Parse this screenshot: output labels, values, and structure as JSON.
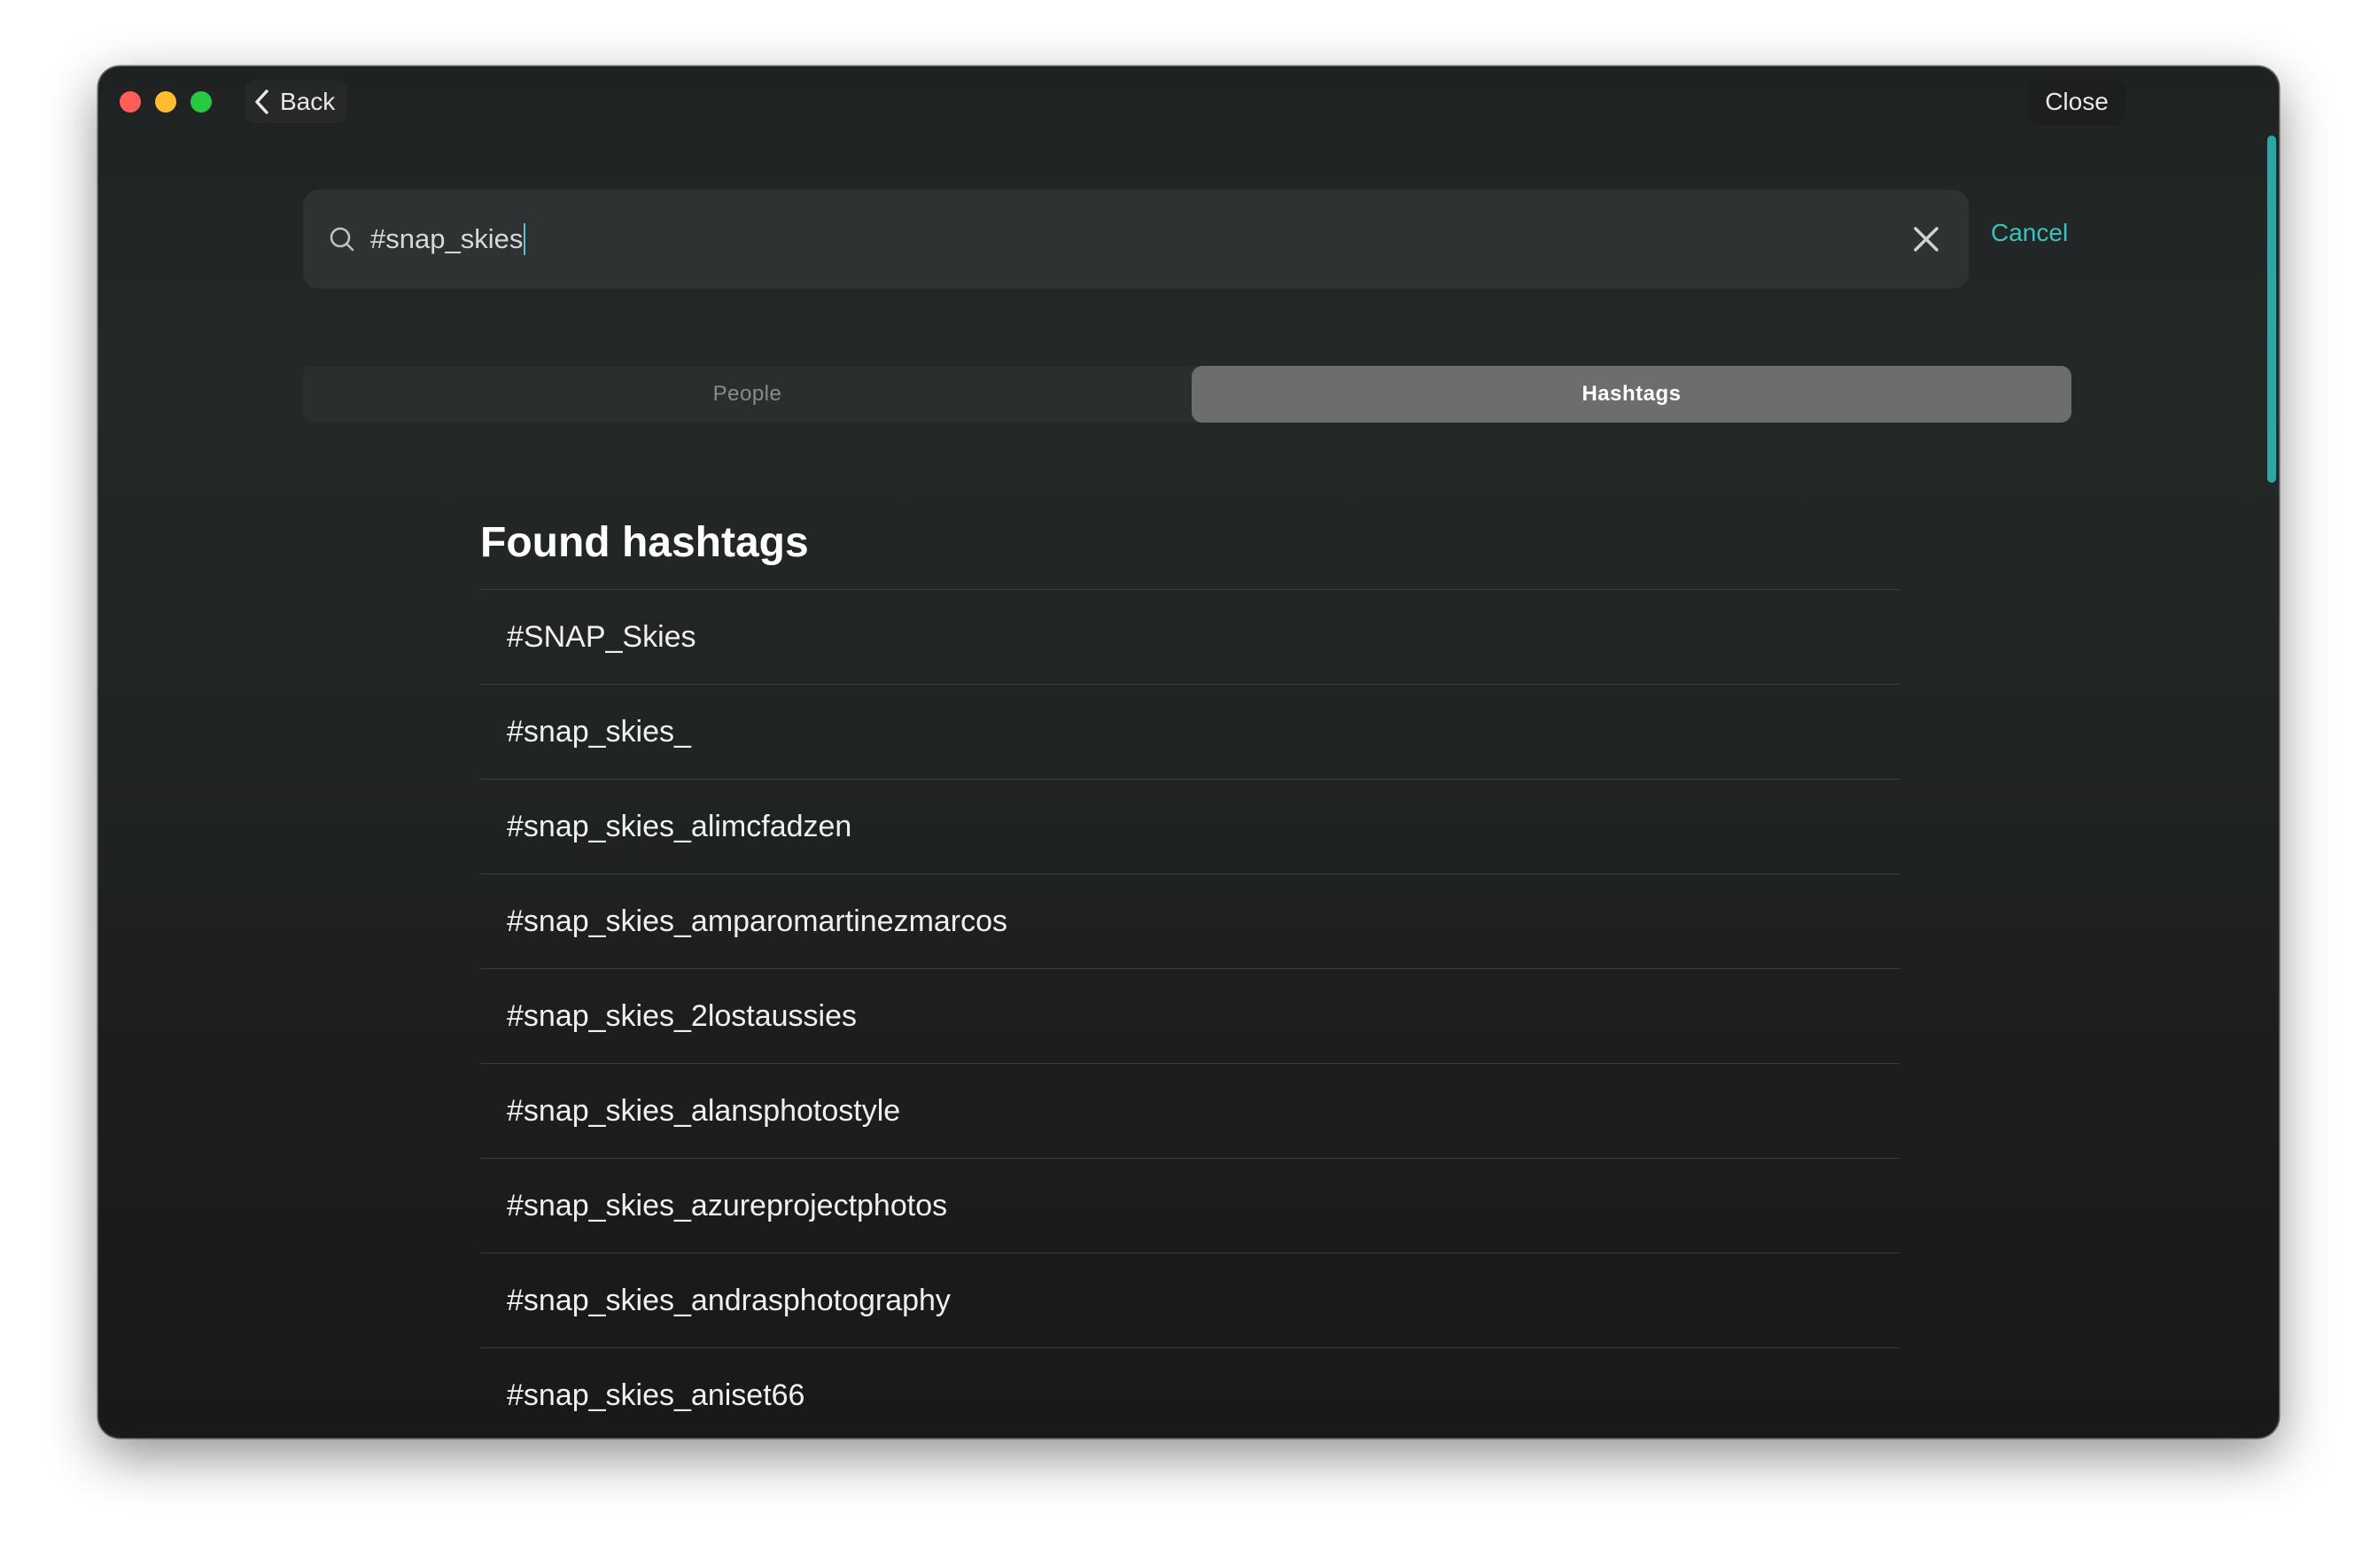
{
  "titlebar": {
    "back_label": "Back",
    "close_label": "Close"
  },
  "search": {
    "value": "#snap_skies",
    "cancel_label": "Cancel"
  },
  "tabs": [
    {
      "label": "People",
      "selected": false
    },
    {
      "label": "Hashtags",
      "selected": true
    }
  ],
  "results": {
    "title": "Found hashtags",
    "items": [
      "#SNAP_Skies",
      "#snap_skies_",
      "#snap_skies_alimcfadzen",
      "#snap_skies_amparomartinezmarcos",
      "#snap_skies_2lostaussies",
      "#snap_skies_alansphotostyle",
      "#snap_skies_azureprojectphotos",
      "#snap_skies_andrasphotography",
      "#snap_skies_aniset66"
    ]
  },
  "colors": {
    "accent": "#3cc1bd",
    "scrollbar": "#2aa8a6",
    "traffic_red": "#ff5f57",
    "traffic_yellow": "#febc2e",
    "traffic_green": "#28c840"
  },
  "icons": {
    "back": "chevron-left-icon",
    "search": "search-icon",
    "clear": "close-icon"
  }
}
